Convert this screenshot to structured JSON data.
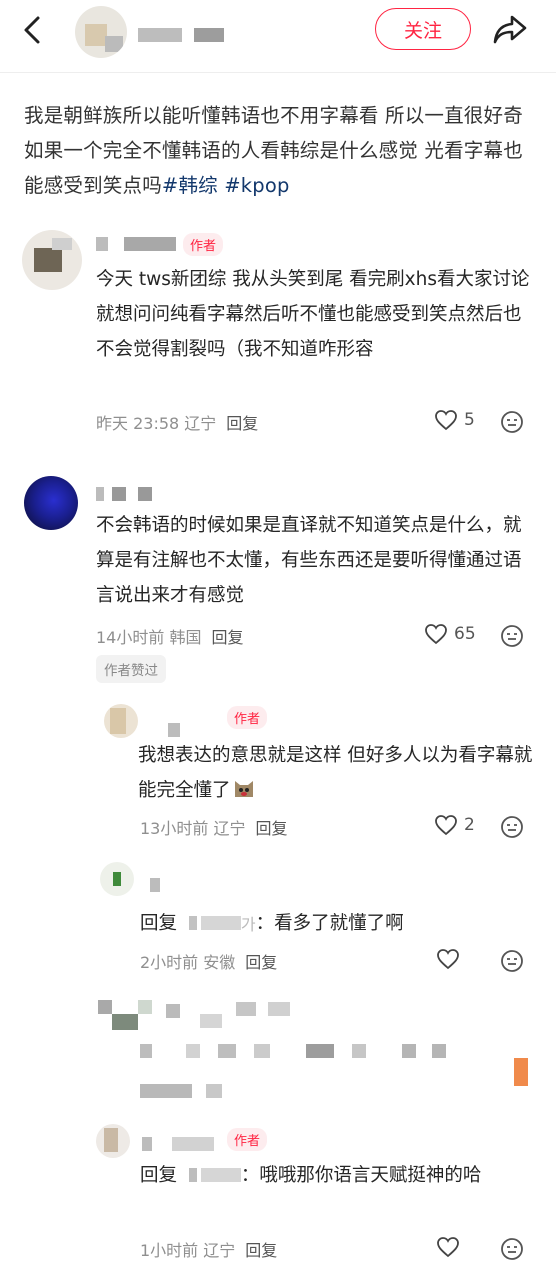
{
  "header": {
    "follow_label": "关注"
  },
  "post": {
    "text": "我是朝鲜族所以能听懂韩语也不用字幕看 所以一直很好奇如果一个完全不懂韩语的人看韩综是什么感觉 光看字幕也能感受到笑点吗",
    "tags": [
      "#韩综",
      "#kpop"
    ]
  },
  "comments": [
    {
      "badge": "作者",
      "text": "今天 tws新团综 我从头笑到尾 看完刷xhs看大家讨论就想问问纯看字幕然后听不懂也能感受到笑点然后也不会觉得割裂吗（我不知道咋形容",
      "time_loc": "昨天 23:58 辽宁",
      "reply": "回复",
      "likes": "5"
    },
    {
      "text": "不会韩语的时候如果是直译就不知道笑点是什么，就算是有注解也不太懂，有些东西还是要听得懂通过语言说出来才有感觉",
      "time_loc": "14小时前 韩国",
      "reply": "回复",
      "likes": "65",
      "liked_by_author": "作者赞过"
    },
    {
      "badge": "作者",
      "text": "我想表达的意思就是这样 但好多人以为看字幕就能完全懂了",
      "time_loc": "13小时前 辽宁",
      "reply": "回复",
      "likes": "2"
    },
    {
      "reply_prefix": "回复",
      "reply_target_suffix": "가",
      "text": "：看多了就懂了啊",
      "time_loc": "2小时前 安徽",
      "reply": "回复"
    },
    {
      "badge": "作者",
      "reply_prefix": "回复",
      "text": "：哦哦那你语言天赋挺神的哈",
      "time_loc": "1小时前 辽宁",
      "reply": "回复"
    }
  ],
  "colors": {
    "accent": "#ff2442",
    "tag": "#13386c"
  }
}
